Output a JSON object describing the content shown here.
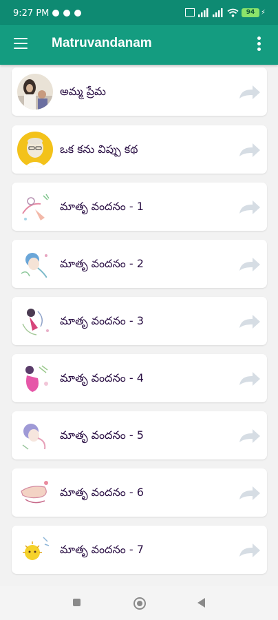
{
  "status_bar": {
    "time": "9:27 PM",
    "battery": "94"
  },
  "app_bar": {
    "title": "Matruvandanam",
    "menu_icon": "hamburger-menu-icon",
    "overflow_icon": "more-vertical-icon"
  },
  "items": [
    {
      "label": "అమ్మ ప్రేమ",
      "thumbnail": "mother-portrait-thumbnail"
    },
    {
      "label": "ఒక కను విప్పు కథ",
      "thumbnail": "poet-portrait-thumbnail"
    },
    {
      "label": "మాతృ వందనం - 1",
      "thumbnail": "sketch-illustration-thumbnail"
    },
    {
      "label": "మాతృ వందనం - 2",
      "thumbnail": "sketch-illustration-thumbnail"
    },
    {
      "label": "మాతృ వందనం - 3",
      "thumbnail": "sketch-illustration-thumbnail"
    },
    {
      "label": "మాతృ వందనం - 4",
      "thumbnail": "sketch-illustration-thumbnail"
    },
    {
      "label": "మాతృ వందనం - 5",
      "thumbnail": "sketch-illustration-thumbnail"
    },
    {
      "label": "మాతృ వందనం - 6",
      "thumbnail": "sketch-illustration-thumbnail"
    },
    {
      "label": "మాతృ వందనం - 7",
      "thumbnail": "sketch-illustration-thumbnail"
    }
  ],
  "item_action_icon": "share-arrow-icon",
  "nav_bar": {
    "recents_icon": "recents-square-icon",
    "home_icon": "home-circle-icon",
    "back_icon": "back-triangle-icon"
  },
  "colors": {
    "status_bar": "#0e8a72",
    "app_bar": "#149c80",
    "background": "#f2f2f2",
    "card": "#ffffff",
    "label_text": "#2a0f44",
    "arrow": "#d6dde4"
  }
}
